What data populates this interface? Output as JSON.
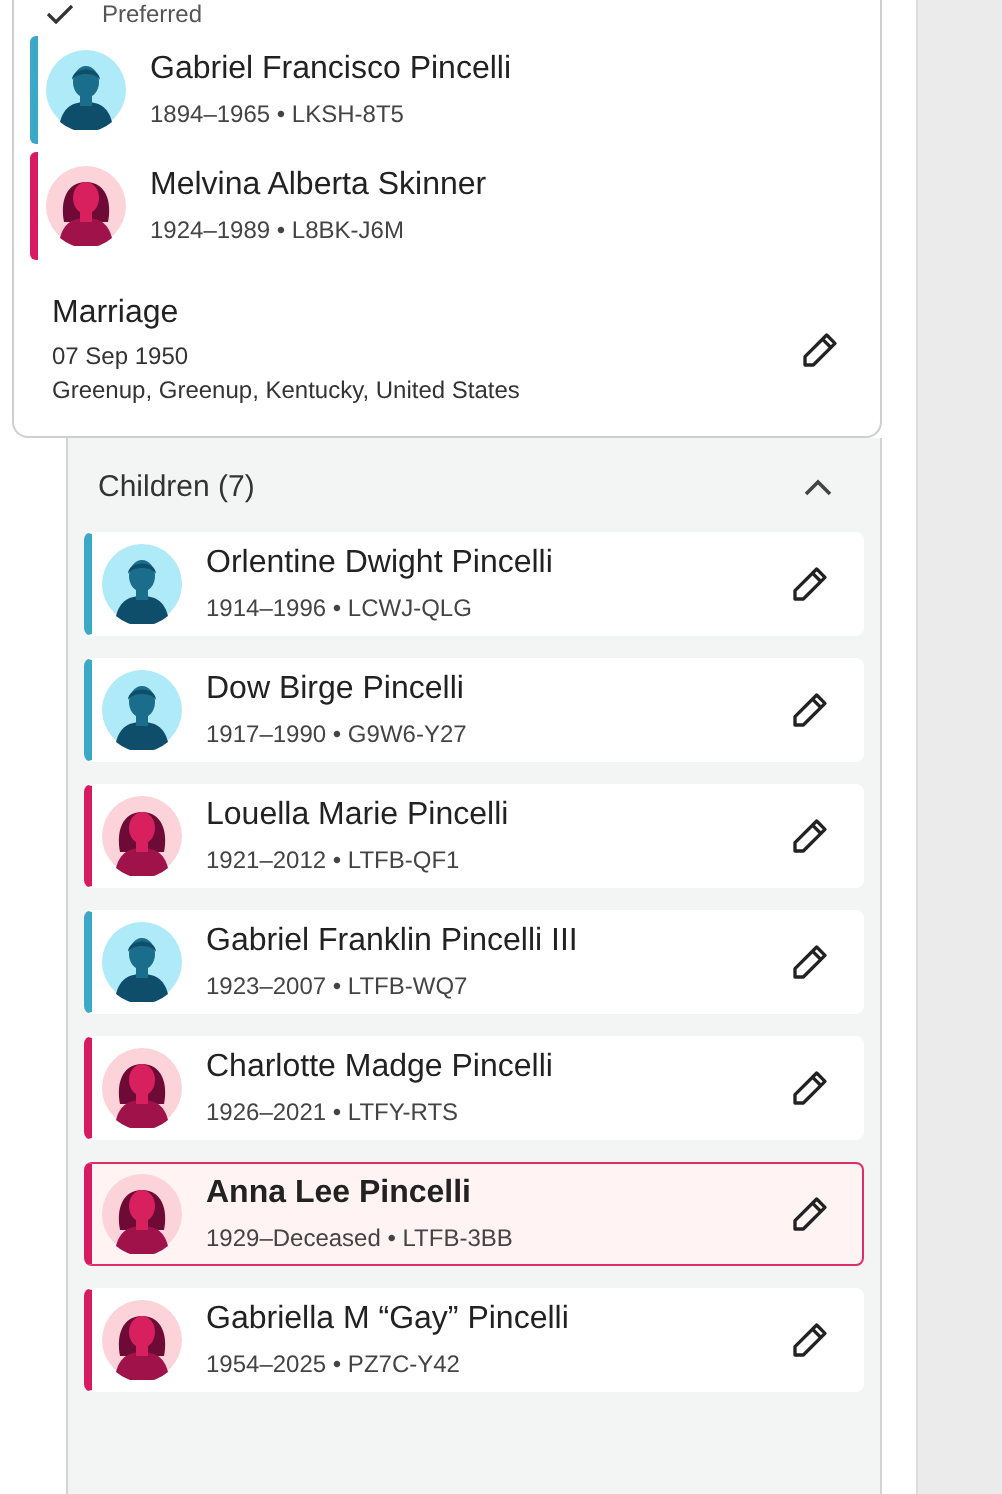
{
  "preferred": {
    "label": "Preferred",
    "checked": true
  },
  "couple": [
    {
      "name": "Gabriel Francisco Pincelli",
      "meta": "1894–1965 • LKSH-8T5",
      "kind": "male"
    },
    {
      "name": "Melvina Alberta Skinner",
      "meta": "1924–1989 • L8BK-J6M",
      "kind": "female"
    }
  ],
  "marriage": {
    "title": "Marriage",
    "date": "07 Sep 1950",
    "place": "Greenup, Greenup, Kentucky, United States"
  },
  "children": {
    "title": "Children (7)",
    "expanded": true,
    "items": [
      {
        "name": "Orlentine Dwight Pincelli",
        "meta": "1914–1996 • LCWJ-QLG",
        "kind": "male",
        "selected": false
      },
      {
        "name": "Dow Birge Pincelli",
        "meta": "1917–1990 • G9W6-Y27",
        "kind": "male",
        "selected": false
      },
      {
        "name": "Louella Marie Pincelli",
        "meta": "1921–2012 • LTFB-QF1",
        "kind": "female",
        "selected": false
      },
      {
        "name": "Gabriel Franklin Pincelli III",
        "meta": "1923–2007 • LTFB-WQ7",
        "kind": "male",
        "selected": false
      },
      {
        "name": "Charlotte Madge Pincelli",
        "meta": "1926–2021 • LTFY-RTS",
        "kind": "female",
        "selected": false
      },
      {
        "name": "Anna Lee Pincelli",
        "meta": "1929–Deceased • LTFB-3BB",
        "kind": "female",
        "selected": true
      },
      {
        "name": "Gabriella M “Gay” Pincelli",
        "meta": "1954–2025 • PZ7C-Y42",
        "kind": "female",
        "selected": false
      }
    ]
  }
}
